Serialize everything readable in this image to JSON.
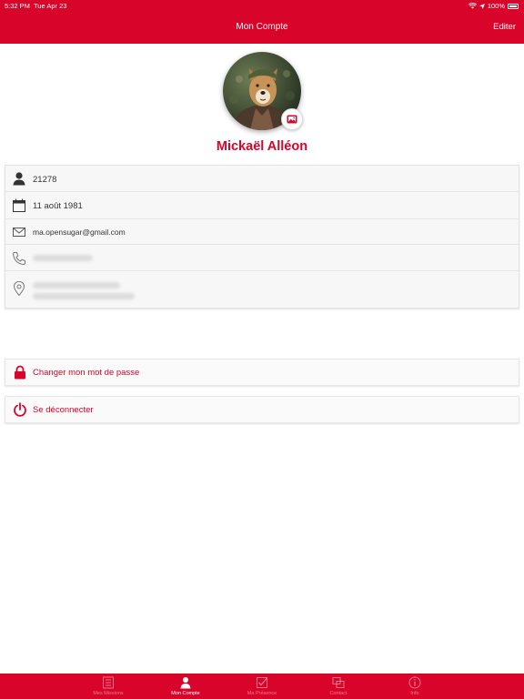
{
  "status_bar": {
    "time": "5:32 PM",
    "date": "Tue Apr 23",
    "battery": "100%"
  },
  "nav": {
    "title": "Mon Compte",
    "edit_label": "Editer"
  },
  "profile": {
    "name": "Mickaël Alléon"
  },
  "info": {
    "id": "21278",
    "birthdate": "11 août 1981",
    "email": "ma.opensugar@gmail.com"
  },
  "actions": {
    "change_password": "Changer mon mot de passe",
    "logout": "Se déconnecter"
  },
  "tabs": [
    {
      "label": "Mes Missions",
      "icon": "list-icon",
      "active": false
    },
    {
      "label": "Mon Compte",
      "icon": "user-icon",
      "active": true
    },
    {
      "label": "Ma Présence",
      "icon": "checkbox-icon",
      "active": false
    },
    {
      "label": "Contact",
      "icon": "contact-icon",
      "active": false
    },
    {
      "label": "Info",
      "icon": "info-icon",
      "active": false
    }
  ],
  "colors": {
    "brand": "#d9042a",
    "card": "#f7f7f7"
  }
}
